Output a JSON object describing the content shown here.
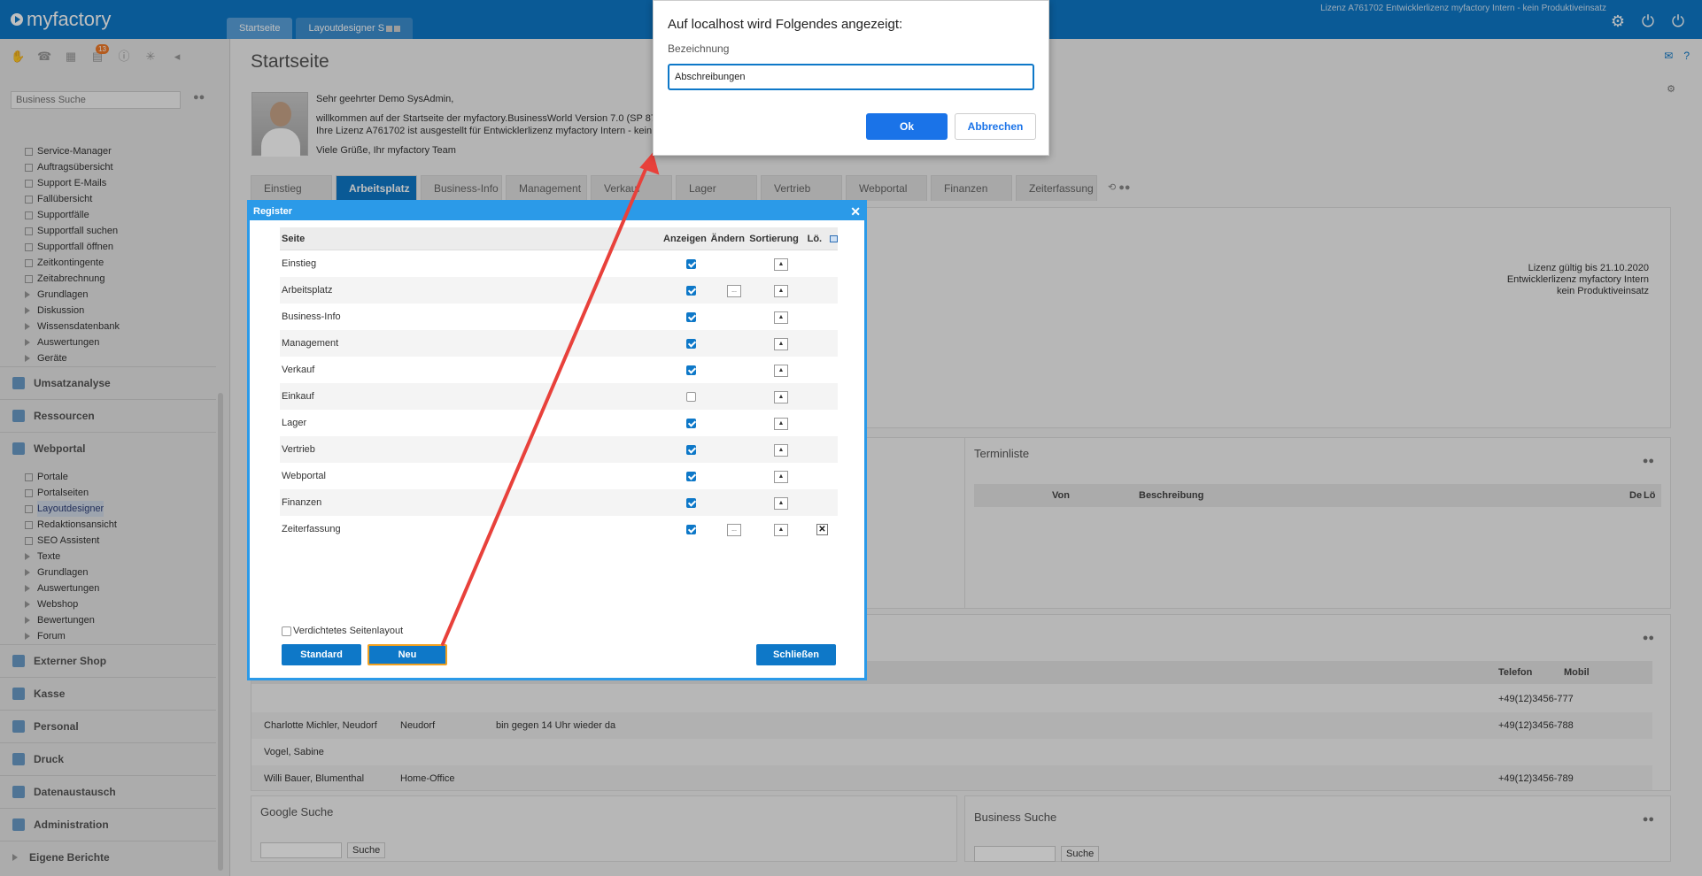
{
  "app": {
    "logo": "myfactory",
    "license_top": "Lizenz A761702 Entwicklerlizenz myfactory Intern - kein Produktiveinsatz"
  },
  "top_tabs": [
    {
      "label": "Startseite"
    },
    {
      "label": "Layoutdesigner S"
    }
  ],
  "sidebar": {
    "badge": "13",
    "search_placeholder": "Business Suche",
    "service_items": [
      "Service-Manager",
      "Auftragsübersicht",
      "Support E-Mails",
      "Fallübersicht",
      "Supportfälle",
      "Supportfall suchen",
      "Supportfall öffnen",
      "Zeitkontingente",
      "Zeitabrechnung",
      "Grundlagen",
      "Diskussion",
      "Wissensdatenbank",
      "Auswertungen",
      "Geräte"
    ],
    "sections_top": [
      "Umsatzanalyse",
      "Ressourcen",
      "Webportal"
    ],
    "webportal_items": [
      "Portale",
      "Portalseiten",
      "Layoutdesigner",
      "Redaktionsansicht",
      "SEO Assistent",
      "Texte",
      "Grundlagen",
      "Auswertungen",
      "Webshop",
      "Bewertungen",
      "Forum"
    ],
    "sections_bottom": [
      "Externer Shop",
      "Kasse",
      "Personal",
      "Druck",
      "Datenaustausch",
      "Administration",
      "Eigene Berichte"
    ]
  },
  "main": {
    "title": "Startseite",
    "greeting": "Sehr geehrter Demo SysAdmin,",
    "welcome1": "willkommen auf der Startseite der myfactory.BusinessWorld Version 7.0 (SP 876",
    "welcome2": "Ihre Lizenz A761702 ist ausgestellt für Entwicklerlizenz myfactory Intern - kein F",
    "welcome3": "Viele Grüße, Ihr myfactory Team",
    "tabs": [
      "Einstieg",
      "Arbeitsplatz",
      "Business-Info",
      "Management",
      "Verkauf",
      "Lager",
      "Vertrieb",
      "Webportal",
      "Finanzen",
      "Zeiterfassung"
    ],
    "license_info": [
      "Lizenz gültig bis 21.10.2020",
      "Entwicklerlizenz myfactory Intern",
      "kein Produktiveinsatz"
    ],
    "terminliste": {
      "title": "Terminliste",
      "col_von": "Von",
      "col_beschreibung": "Beschreibung",
      "col_de": "De",
      "col_lo": "Lö"
    },
    "contacts": {
      "col_telefon": "Telefon",
      "col_mobil": "Mobil",
      "rows": [
        {
          "name": "",
          "ort": "",
          "status": "",
          "tel": "+49(12)3456-777"
        },
        {
          "name": "Charlotte Michler, Neudorf",
          "ort": "Neudorf",
          "status": "bin gegen 14 Uhr wieder da",
          "tel": "+49(12)3456-788"
        },
        {
          "name": "Vogel, Sabine",
          "ort": "",
          "status": "",
          "tel": ""
        },
        {
          "name": "Willi Bauer, Blumenthal",
          "ort": "Home-Office",
          "status": "",
          "tel": "+49(12)3456-789"
        }
      ]
    },
    "google": {
      "title": "Google Suche",
      "button": "Suche"
    },
    "business": {
      "title": "Business Suche",
      "button": "Suche"
    }
  },
  "register": {
    "title": "Register",
    "headers": {
      "seite": "Seite",
      "anzeigen": "Anzeigen",
      "aendern": "Ändern",
      "sortierung": "Sortierung",
      "loeschen": "Lö."
    },
    "rows": [
      {
        "seite": "Einstieg",
        "anzeigen": true,
        "aendern": false,
        "loeschen": false
      },
      {
        "seite": "Arbeitsplatz",
        "anzeigen": true,
        "aendern": true,
        "loeschen": false
      },
      {
        "seite": "Business-Info",
        "anzeigen": true,
        "aendern": false,
        "loeschen": false
      },
      {
        "seite": "Management",
        "anzeigen": true,
        "aendern": false,
        "loeschen": false
      },
      {
        "seite": "Verkauf",
        "anzeigen": true,
        "aendern": false,
        "loeschen": false
      },
      {
        "seite": "Einkauf",
        "anzeigen": false,
        "aendern": false,
        "loeschen": false
      },
      {
        "seite": "Lager",
        "anzeigen": true,
        "aendern": false,
        "loeschen": false
      },
      {
        "seite": "Vertrieb",
        "anzeigen": true,
        "aendern": false,
        "loeschen": false
      },
      {
        "seite": "Webportal",
        "anzeigen": true,
        "aendern": false,
        "loeschen": false
      },
      {
        "seite": "Finanzen",
        "anzeigen": true,
        "aendern": false,
        "loeschen": false
      },
      {
        "seite": "Zeiterfassung",
        "anzeigen": true,
        "aendern": true,
        "loeschen": true
      }
    ],
    "compact_label": "Verdichtetes Seitenlayout",
    "btn_standard": "Standard",
    "btn_neu": "Neu",
    "btn_schliessen": "Schließen"
  },
  "prompt": {
    "title": "Auf localhost wird Folgendes angezeigt:",
    "label": "Bezeichnung",
    "value": "Abschreibungen",
    "ok": "Ok",
    "cancel": "Abbrechen"
  },
  "colors": {
    "brand": "#0e78c8",
    "arrow": "#e8413b",
    "highlight": "#f0a020"
  }
}
